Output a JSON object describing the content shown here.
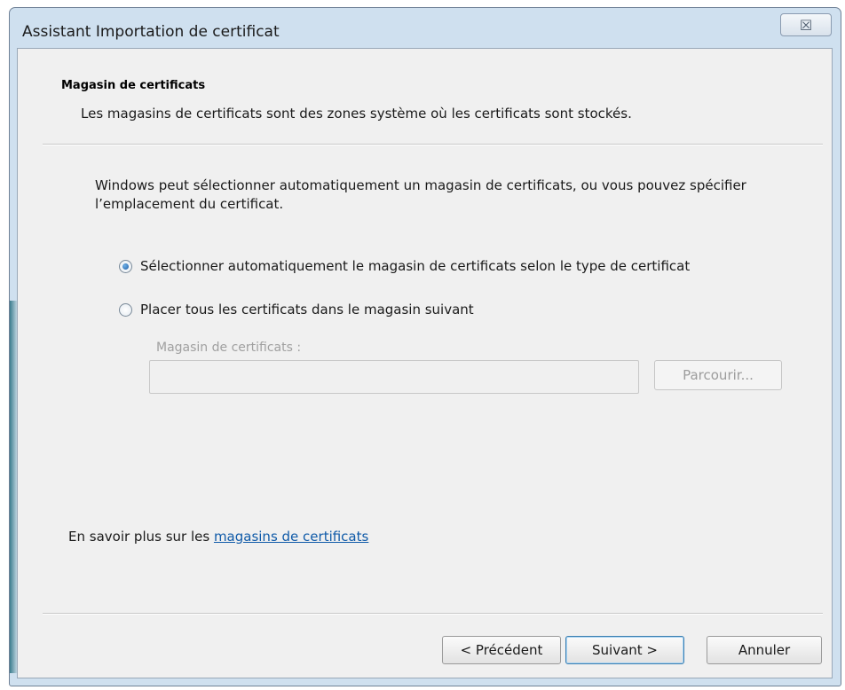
{
  "window": {
    "title": "Assistant Importation de certificat",
    "close_symbol": "☒"
  },
  "header": {
    "title": "Magasin de certificats",
    "description": "Les magasins de certificats sont des zones système où les certificats sont stockés."
  },
  "body": {
    "intro": "Windows peut sélectionner automatiquement un magasin de certificats, ou vous pouvez spécifier l’emplacement du certificat.",
    "options": [
      {
        "label": "Sélectionner automatiquement le magasin de certificats selon le type de certificat",
        "selected": true
      },
      {
        "label": "Placer tous les certificats dans le magasin suivant",
        "selected": false
      }
    ],
    "store_label": "Magasin de certificats :",
    "store_value": "",
    "browse_label": "Parcourir..."
  },
  "learn_more": {
    "prefix": "En savoir plus sur les ",
    "link_text": "magasins de certificats"
  },
  "buttons": {
    "back": "< Précédent",
    "next": "Suivant >",
    "cancel": "Annuler"
  },
  "colors": {
    "frame": "#cfe0ef",
    "client_bg": "#f0f0f0",
    "link": "#0f5aa8"
  }
}
